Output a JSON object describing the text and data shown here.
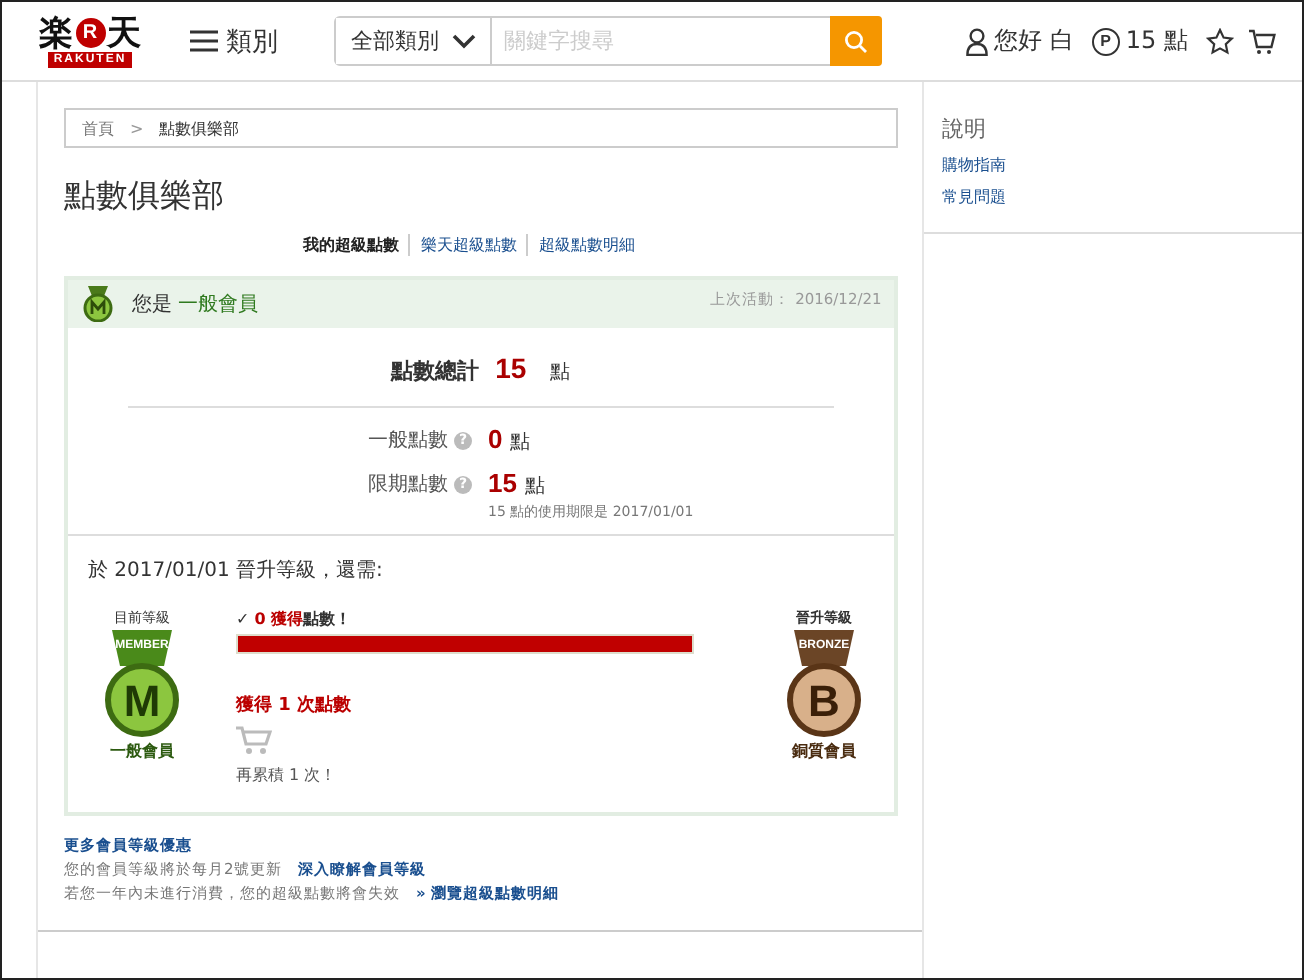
{
  "header": {
    "logo": {
      "left": "楽",
      "mark": "R",
      "right": "天",
      "sub": "RAKUTEN"
    },
    "menu": "類別",
    "search": {
      "category": "全部類別",
      "placeholder": "關鍵字搜尋"
    },
    "user": "您好 白",
    "points_icon": "P",
    "points": "15 點"
  },
  "breadcrumb": [
    {
      "label": "首頁",
      "link": true
    },
    {
      "label": "點數俱樂部",
      "link": false
    }
  ],
  "breadcrumb_separator": ">",
  "title": "點數俱樂部",
  "tabs": [
    {
      "label": "我的超級點數",
      "selected": true
    },
    {
      "label": "樂天超級點數",
      "selected": false
    },
    {
      "label": "超級點數明細",
      "selected": false
    }
  ],
  "member": {
    "prefix": "您是",
    "level": "一般會員",
    "last_activity": "上次活動： 2016/12/21",
    "total_label": "點數總計",
    "total_value": "15",
    "unit": "點",
    "rows": [
      {
        "label": "一般點數",
        "help": "?",
        "value": "0",
        "unit": "點"
      },
      {
        "label": "限期點數",
        "help": "?",
        "value": "15",
        "unit": "點",
        "note": "15 點的使用期限是 2017/01/01"
      }
    ],
    "upgrade_text": "於 2017/01/01 晉升等級，還需:",
    "current": {
      "caption": "目前等級",
      "ribbon": "MEMBER",
      "letter": "M",
      "name": "一般會員"
    },
    "next": {
      "caption": "晉升等級",
      "ribbon": "BRONZE",
      "letter": "B",
      "name": "銅質會員"
    },
    "goals": [
      {
        "kind": "progress",
        "check": "✓",
        "count": "0",
        "verb": "獲得",
        "rest": "點數！",
        "level": 1
      },
      {
        "kind": "count",
        "text": "獲得 1 次點數",
        "remaining": "再累積 1 次！"
      }
    ]
  },
  "footer": {
    "heading": "更多會員等級優惠",
    "lines": [
      {
        "text": "您的會員等級將於每月2號更新",
        "link": "深入瞭解會員等級"
      },
      {
        "text": "若您一年內未進行消費，您的超級點數將會失效",
        "link": "» 瀏覽超級點數明細"
      }
    ]
  },
  "sidebar": {
    "heading": "說明",
    "links": [
      "購物指南",
      "常見問題"
    ]
  }
}
